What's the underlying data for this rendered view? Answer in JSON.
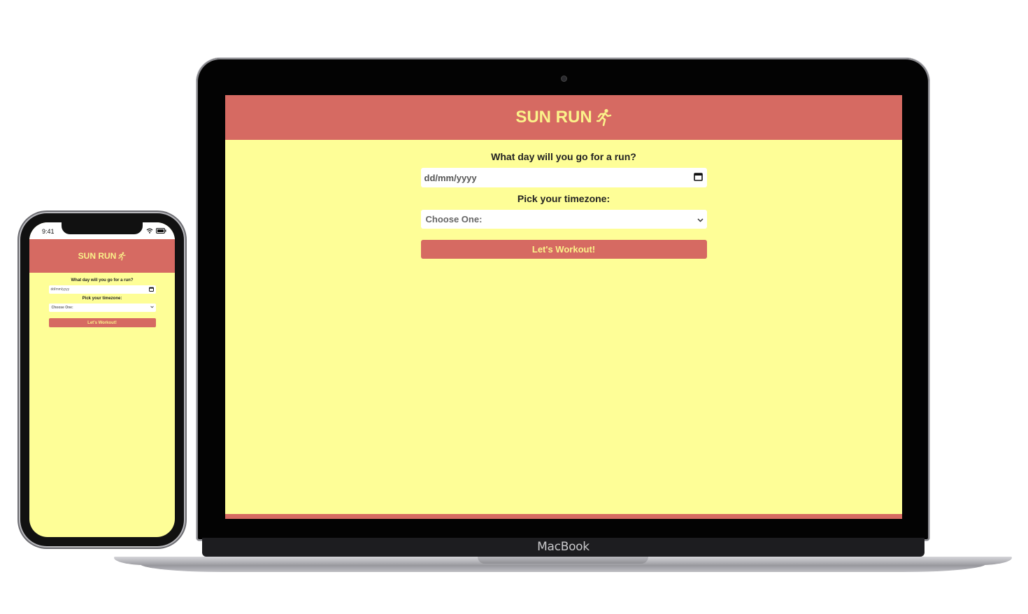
{
  "laptop": {
    "brand": "MacBook",
    "app": {
      "title": "SUN RUN",
      "icon": "runner-icon",
      "date_question": "What day will you go for a run?",
      "date_placeholder": "dd/mm/yyyy",
      "timezone_label": "Pick your timezone:",
      "timezone_selected": "Choose One:",
      "button_label": "Let's Workout!"
    }
  },
  "phone": {
    "status_time": "9:41",
    "app": {
      "title": "SUN RUN",
      "icon": "runner-icon",
      "date_question": "What day will you go for a run?",
      "date_placeholder": "dd/mm/yyyy",
      "timezone_label": "Pick your timezone:",
      "timezone_selected": "Choose One:",
      "button_label": "Let's Workout!"
    }
  },
  "colors": {
    "header": "#d66a62",
    "background": "#fefe97",
    "title_text": "#fbf28a"
  }
}
